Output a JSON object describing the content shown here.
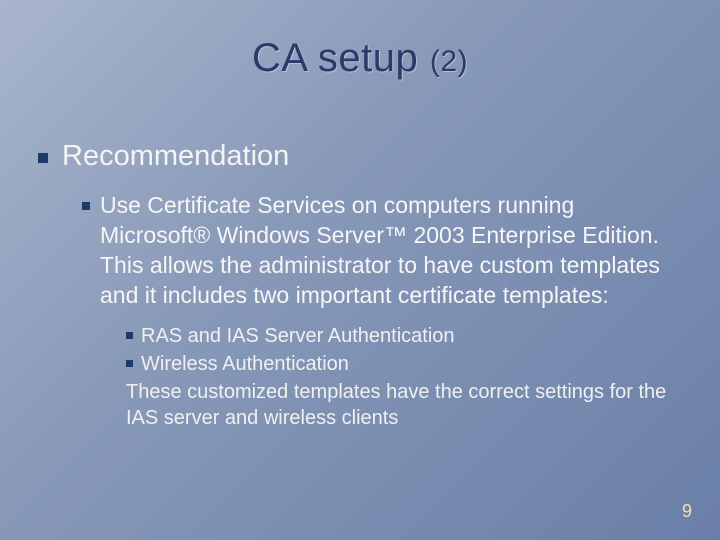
{
  "title": {
    "main": "CA setup",
    "sub": "(2)"
  },
  "bullets": {
    "lvl1": "Recommendation",
    "lvl2": "Use Certificate Services on computers running Microsoft® Windows Server™ 2003 Enterprise Edition. This allows the administrator to have custom templates and it includes two important certificate templates:",
    "lvl3": {
      "item1": "RAS and IAS Server Authentication",
      "item2": "Wireless Authentication",
      "trailer": "These customized templates have the correct settings for the IAS server and wireless clients"
    }
  },
  "page_number": "9"
}
